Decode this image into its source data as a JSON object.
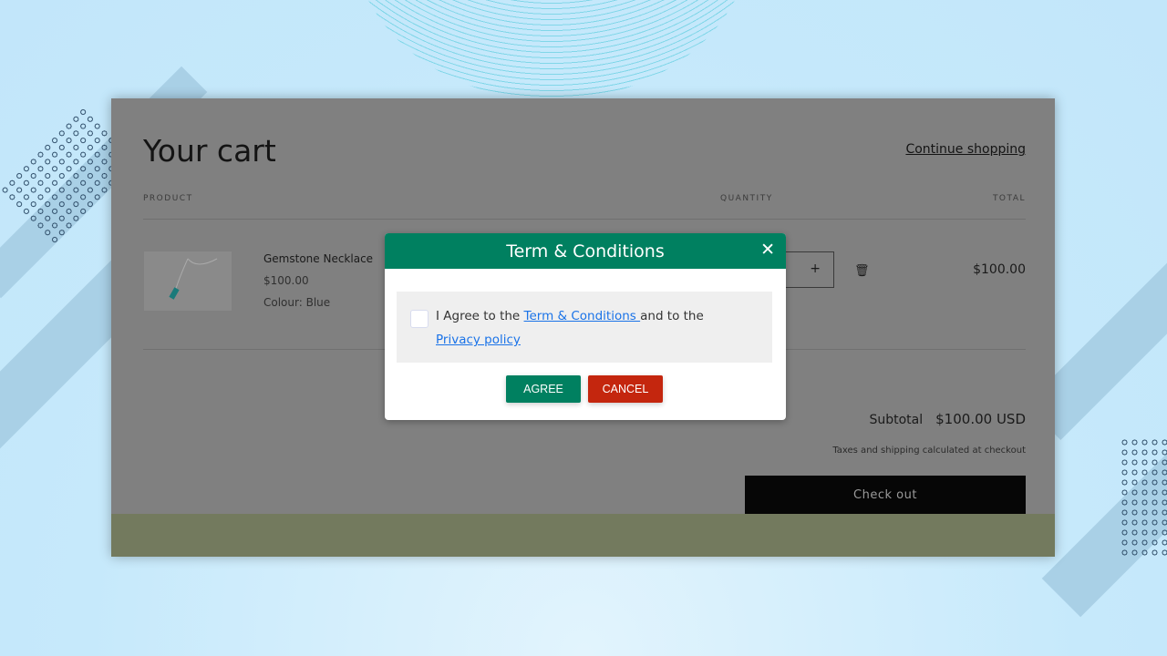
{
  "cart": {
    "title": "Your cart",
    "continue": "Continue shopping",
    "headers": {
      "product": "PRODUCT",
      "quantity": "QUANTITY",
      "total": "TOTAL"
    },
    "item": {
      "name": "Gemstone Necklace",
      "price": "$100.00",
      "variant": "Colour: Blue",
      "total": "$100.00"
    },
    "subtotal_label": "Subtotal",
    "subtotal": "$100.00 USD",
    "tax_note": "Taxes and shipping calculated at checkout",
    "checkout": "Check out"
  },
  "modal": {
    "title": "Term & Conditions",
    "text1": "I Agree to the ",
    "link1": "Term & Conditions ",
    "text2": "and to the ",
    "link2": "Privacy policy",
    "agree": "AGREE",
    "cancel": "CANCEL"
  },
  "colors": {
    "accent": "#008060",
    "cancel": "#c4260e",
    "link": "#1a73e8"
  }
}
